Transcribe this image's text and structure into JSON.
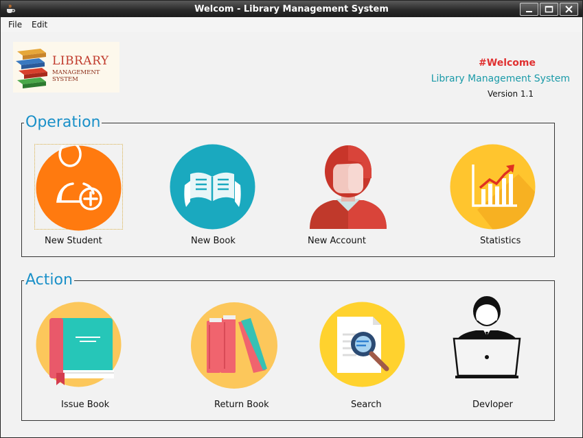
{
  "window": {
    "title": "Welcom - Library Management System"
  },
  "menu": {
    "file": "File",
    "edit": "Edit"
  },
  "logo": {
    "line1": "LIBRARY",
    "line2": "MANAGEMENT SYSTEM"
  },
  "header": {
    "welcome": "#Welcome",
    "subtitle": "Library Management System",
    "version": "Version 1.1"
  },
  "operation": {
    "title": "Operation",
    "items": [
      {
        "label": "New Student",
        "icon": "add-user-icon"
      },
      {
        "label": "New Book",
        "icon": "open-book-icon"
      },
      {
        "label": "New Account",
        "icon": "account-person-icon"
      },
      {
        "label": "Statistics",
        "icon": "statistics-chart-icon"
      }
    ]
  },
  "action": {
    "title": "Action",
    "items": [
      {
        "label": "Issue Book",
        "icon": "closed-book-icon"
      },
      {
        "label": "Return Book",
        "icon": "books-stack-icon"
      },
      {
        "label": "Search",
        "icon": "document-search-icon"
      },
      {
        "label": "Devloper",
        "icon": "developer-laptop-icon"
      }
    ]
  },
  "colors": {
    "student": "#ff7a0f",
    "book": "#1aa9bf",
    "account_hair": "#d94a38",
    "stats": "#ffc52e",
    "welcome": "#e03030",
    "subtitle": "#1a9aa8",
    "group_title": "#1a90c8"
  }
}
